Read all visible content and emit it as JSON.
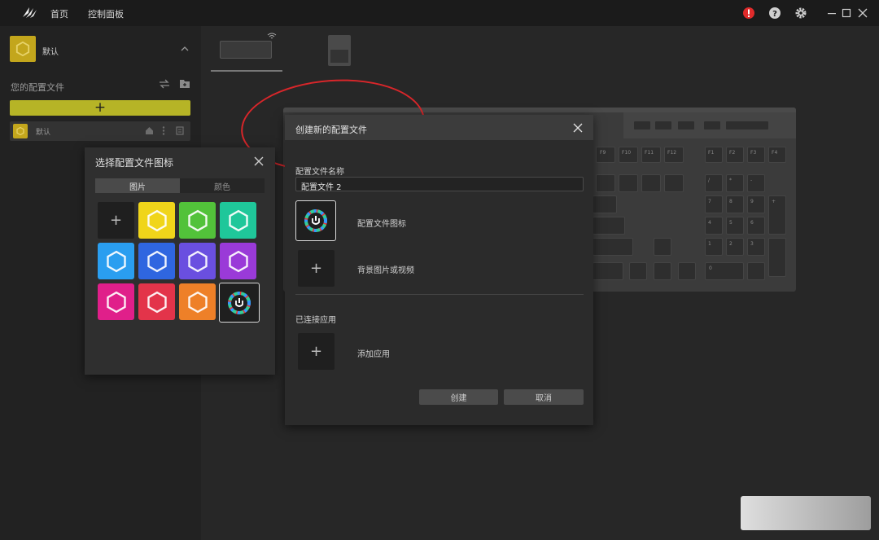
{
  "topbar": {
    "nav": [
      "首页",
      "控制面板"
    ],
    "colors": {
      "alert": "#e02b2b"
    }
  },
  "sidebar": {
    "current_profile": "默认",
    "section_title": "您的配置文件",
    "add_label": "+",
    "profiles": [
      {
        "label": "默认"
      }
    ],
    "colors": {
      "accent": "#b6b426",
      "profile_icon": "#c3a61c"
    }
  },
  "icon_picker": {
    "title": "选择配置文件图标",
    "tabs": [
      "图片",
      "颜色"
    ],
    "add_label": "+",
    "tiles": [
      {
        "color": "#f0d51a",
        "icon": "hexagon-icon"
      },
      {
        "color": "#52c23a",
        "icon": "hexagon-icon"
      },
      {
        "color": "#1fc79a",
        "icon": "hexagon-icon"
      },
      {
        "color": "#2a9ef0",
        "icon": "hexagon-icon"
      },
      {
        "color": "#2f66e0",
        "icon": "hexagon-icon"
      },
      {
        "color": "#6a4fe0",
        "icon": "hexagon-icon"
      },
      {
        "color": "#9a3ad8",
        "icon": "hexagon-icon"
      },
      {
        "color": "#e01f8a",
        "icon": "hexagon-icon"
      },
      {
        "color": "#e3344a",
        "icon": "hexagon-icon"
      },
      {
        "color": "#ee8028",
        "icon": "hexagon-icon"
      }
    ],
    "selected_icon": "icue-logo-icon"
  },
  "dialog": {
    "title": "创建新的配置文件",
    "name_label": "配置文件名称",
    "name_value": "配置文件 2",
    "icon_label": "配置文件图标",
    "bg_label": "背景图片或视频",
    "apps_title": "已连接应用",
    "add_app_label": "添加应用",
    "plus": "+",
    "create_button": "创建",
    "cancel_button": "取消"
  },
  "keyboard": {
    "keys": [
      "F9",
      "F10",
      "F11",
      "F12",
      "F1",
      "F2",
      "F3",
      "F4",
      "7",
      "8",
      "9",
      "4",
      "5",
      "6",
      "1",
      "2",
      "3",
      "0",
      "+",
      "-",
      "*",
      "/"
    ]
  }
}
